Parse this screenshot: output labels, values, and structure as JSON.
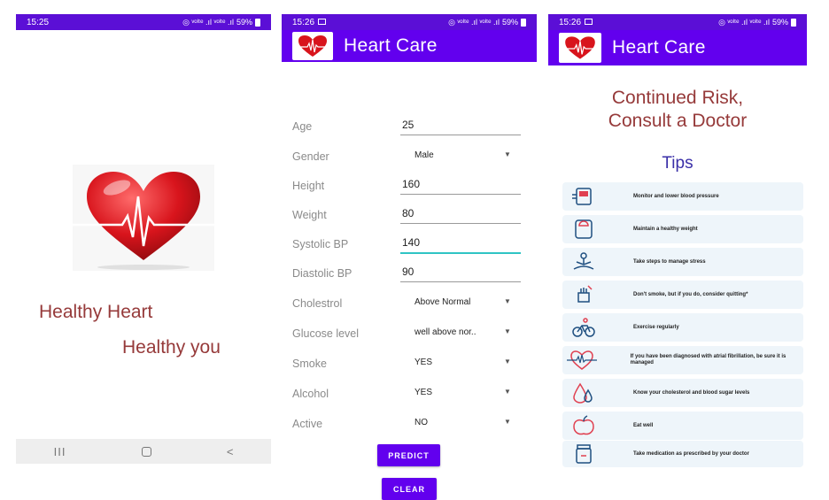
{
  "screens": {
    "splash": {
      "time": "15:25",
      "status_icons": "◎ ᵛᵒˡᵗᵉ .ıl ᵛᵒˡᵗᵉ .ıl",
      "battery": "59%",
      "tagline_1": "Healthy Heart",
      "tagline_2": "Healthy you",
      "nav": {
        "recent": "III",
        "back": "<"
      }
    },
    "form": {
      "time": "15:26",
      "status_icons": "◎ ᵛᵒˡᵗᵉ .ıl ᵛᵒˡᵗᵉ .ıl",
      "battery": "59%",
      "app_title": "Heart Care",
      "fields": {
        "age": {
          "label": "Age",
          "value": "25"
        },
        "gender": {
          "label": "Gender",
          "value": "Male"
        },
        "height": {
          "label": "Height",
          "value": "160"
        },
        "weight": {
          "label": "Weight",
          "value": "80"
        },
        "systolic": {
          "label": "Systolic BP",
          "value": "140"
        },
        "diastolic": {
          "label": "Diastolic BP",
          "value": "90"
        },
        "cholesterol": {
          "label": "Cholestrol",
          "value": "Above Normal"
        },
        "glucose": {
          "label": "Glucose level",
          "value": "well above nor.."
        },
        "smoke": {
          "label": "Smoke",
          "value": "YES"
        },
        "alcohol": {
          "label": "Alcohol",
          "value": "YES"
        },
        "active": {
          "label": "Active",
          "value": "NO"
        }
      },
      "predict_label": "PREDICT",
      "clear_label": "CLEAR"
    },
    "result": {
      "time": "15:26",
      "status_icons": "◎ ᵛᵒˡᵗᵉ .ıl ᵛᵒˡᵗᵉ .ıl",
      "battery": "59%",
      "app_title": "Heart Care",
      "result_line_1": "Continued Risk,",
      "result_line_2": "Consult a Doctor",
      "tips_title": "Tips",
      "tips": [
        {
          "icon": "blood-pressure-icon",
          "text": "Monitor and lower blood pressure"
        },
        {
          "icon": "scale-icon",
          "text": "Maintain a healthy weight"
        },
        {
          "icon": "meditation-icon",
          "text": "Take steps to manage stress"
        },
        {
          "icon": "no-smoking-icon",
          "text": "Don't smoke, but if you do, consider quitting*"
        },
        {
          "icon": "bicycle-icon",
          "text": "Exercise regularly"
        },
        {
          "icon": "heartbeat-icon",
          "text": "If you have been diagnosed with atrial fibrillation, be sure it is managed"
        },
        {
          "icon": "blood-drop-icon",
          "text": "Know your cholesterol and blood sugar levels"
        },
        {
          "icon": "apple-icon",
          "text": "Eat well"
        },
        {
          "icon": "medication-icon",
          "text": "Take medication as prescribed by your doctor"
        }
      ]
    }
  },
  "colors": {
    "status_bar": "#5b0fd6",
    "app_bar": "#6200ee",
    "accent_text": "#963a3a",
    "tips_title": "#3a2fa8",
    "tip_bg": "#eef5fa",
    "focus_line": "#2fc4c4"
  }
}
